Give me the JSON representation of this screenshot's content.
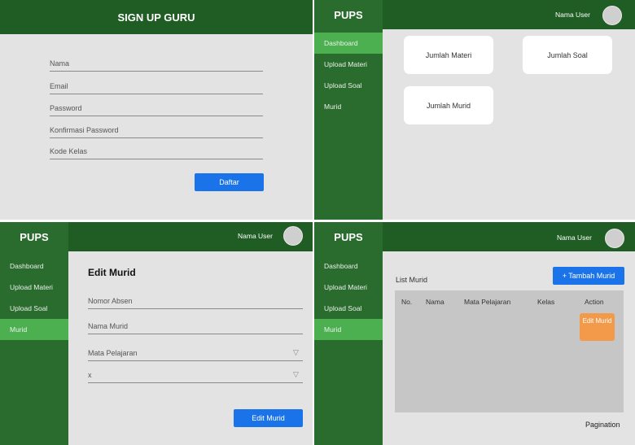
{
  "signup": {
    "title": "SIGN UP GURU",
    "fields": [
      "Nama",
      "Email",
      "Password",
      "Konfirmasi Password",
      "Kode Kelas"
    ],
    "submit_label": "Daftar"
  },
  "dashboard": {
    "brand": "PUPS",
    "user_name": "Nama User",
    "nav": [
      "Dashboard",
      "Upload Materi",
      "Upload Soal",
      "Murid"
    ],
    "cards": [
      "Jumlah Materi",
      "Jumlah Soal",
      "Jumlah Murid"
    ]
  },
  "edit": {
    "brand": "PUPS",
    "user_name": "Nama User",
    "nav": [
      "Dashboard",
      "Upload Materi",
      "Upload Soal",
      "Murid"
    ],
    "title": "Edit Murid",
    "fields": [
      "Nomor Absen",
      "Nama Murid"
    ],
    "selects": [
      "Mata Pelajaran",
      "x"
    ],
    "submit_label": "Edit Murid"
  },
  "list": {
    "brand": "PUPS",
    "user_name": "Nama User",
    "nav": [
      "Dashboard",
      "Upload Materi",
      "Upload Soal",
      "Murid"
    ],
    "title": "List Murid",
    "add_label": "+ Tambah Murid",
    "columns": [
      "No.",
      "Nama",
      "Mata Pelajaran",
      "Kelas",
      "Action"
    ],
    "row_action": "Edit Murid",
    "pagination": "Pagination"
  },
  "colors": {
    "header_green": "#1f5d24",
    "sidebar_green": "#2a6b2e",
    "active_green": "#4caf50",
    "primary_blue": "#1a73e8",
    "action_orange": "#f29a4a"
  }
}
